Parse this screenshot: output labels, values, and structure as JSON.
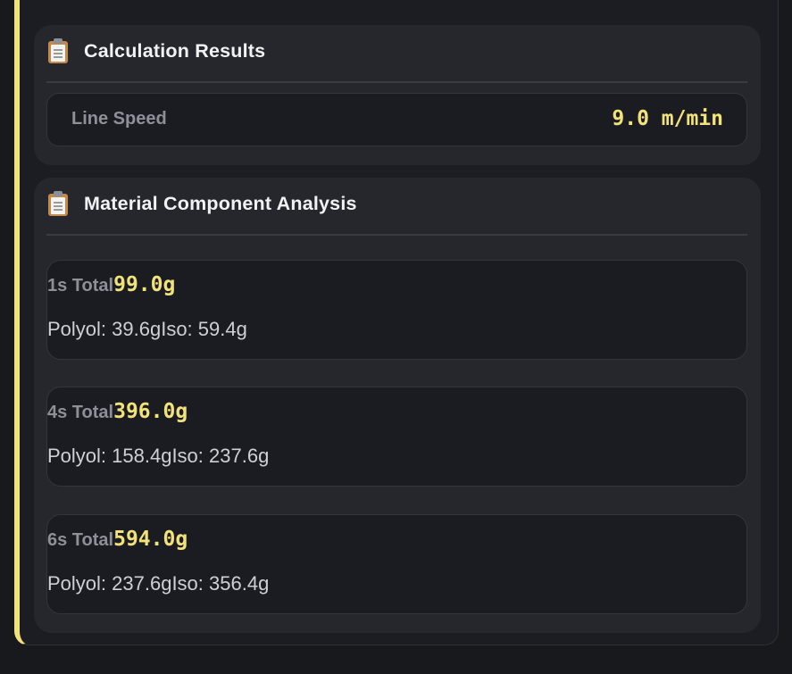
{
  "results": {
    "title": "Calculation Results",
    "icon": "clipboard-icon",
    "line_speed_label": "Line Speed",
    "line_speed_value": "9.0 m/min"
  },
  "material": {
    "title": "Material Component Analysis",
    "icon": "clipboard-icon",
    "items": [
      {
        "label": "1s Total",
        "total": "99.0g",
        "polyol": "Polyol: 39.6g",
        "iso": "Iso: 59.4g"
      },
      {
        "label": "4s Total",
        "total": "396.0g",
        "polyol": "Polyol: 158.4g",
        "iso": "Iso: 237.6g"
      },
      {
        "label": "6s Total",
        "total": "594.0g",
        "polyol": "Polyol: 237.6g",
        "iso": "Iso: 356.4g"
      }
    ]
  },
  "colors": {
    "accent": "#f2e27a",
    "background": "#18191d",
    "card": "#25272d",
    "inset": "#1b1c21"
  }
}
